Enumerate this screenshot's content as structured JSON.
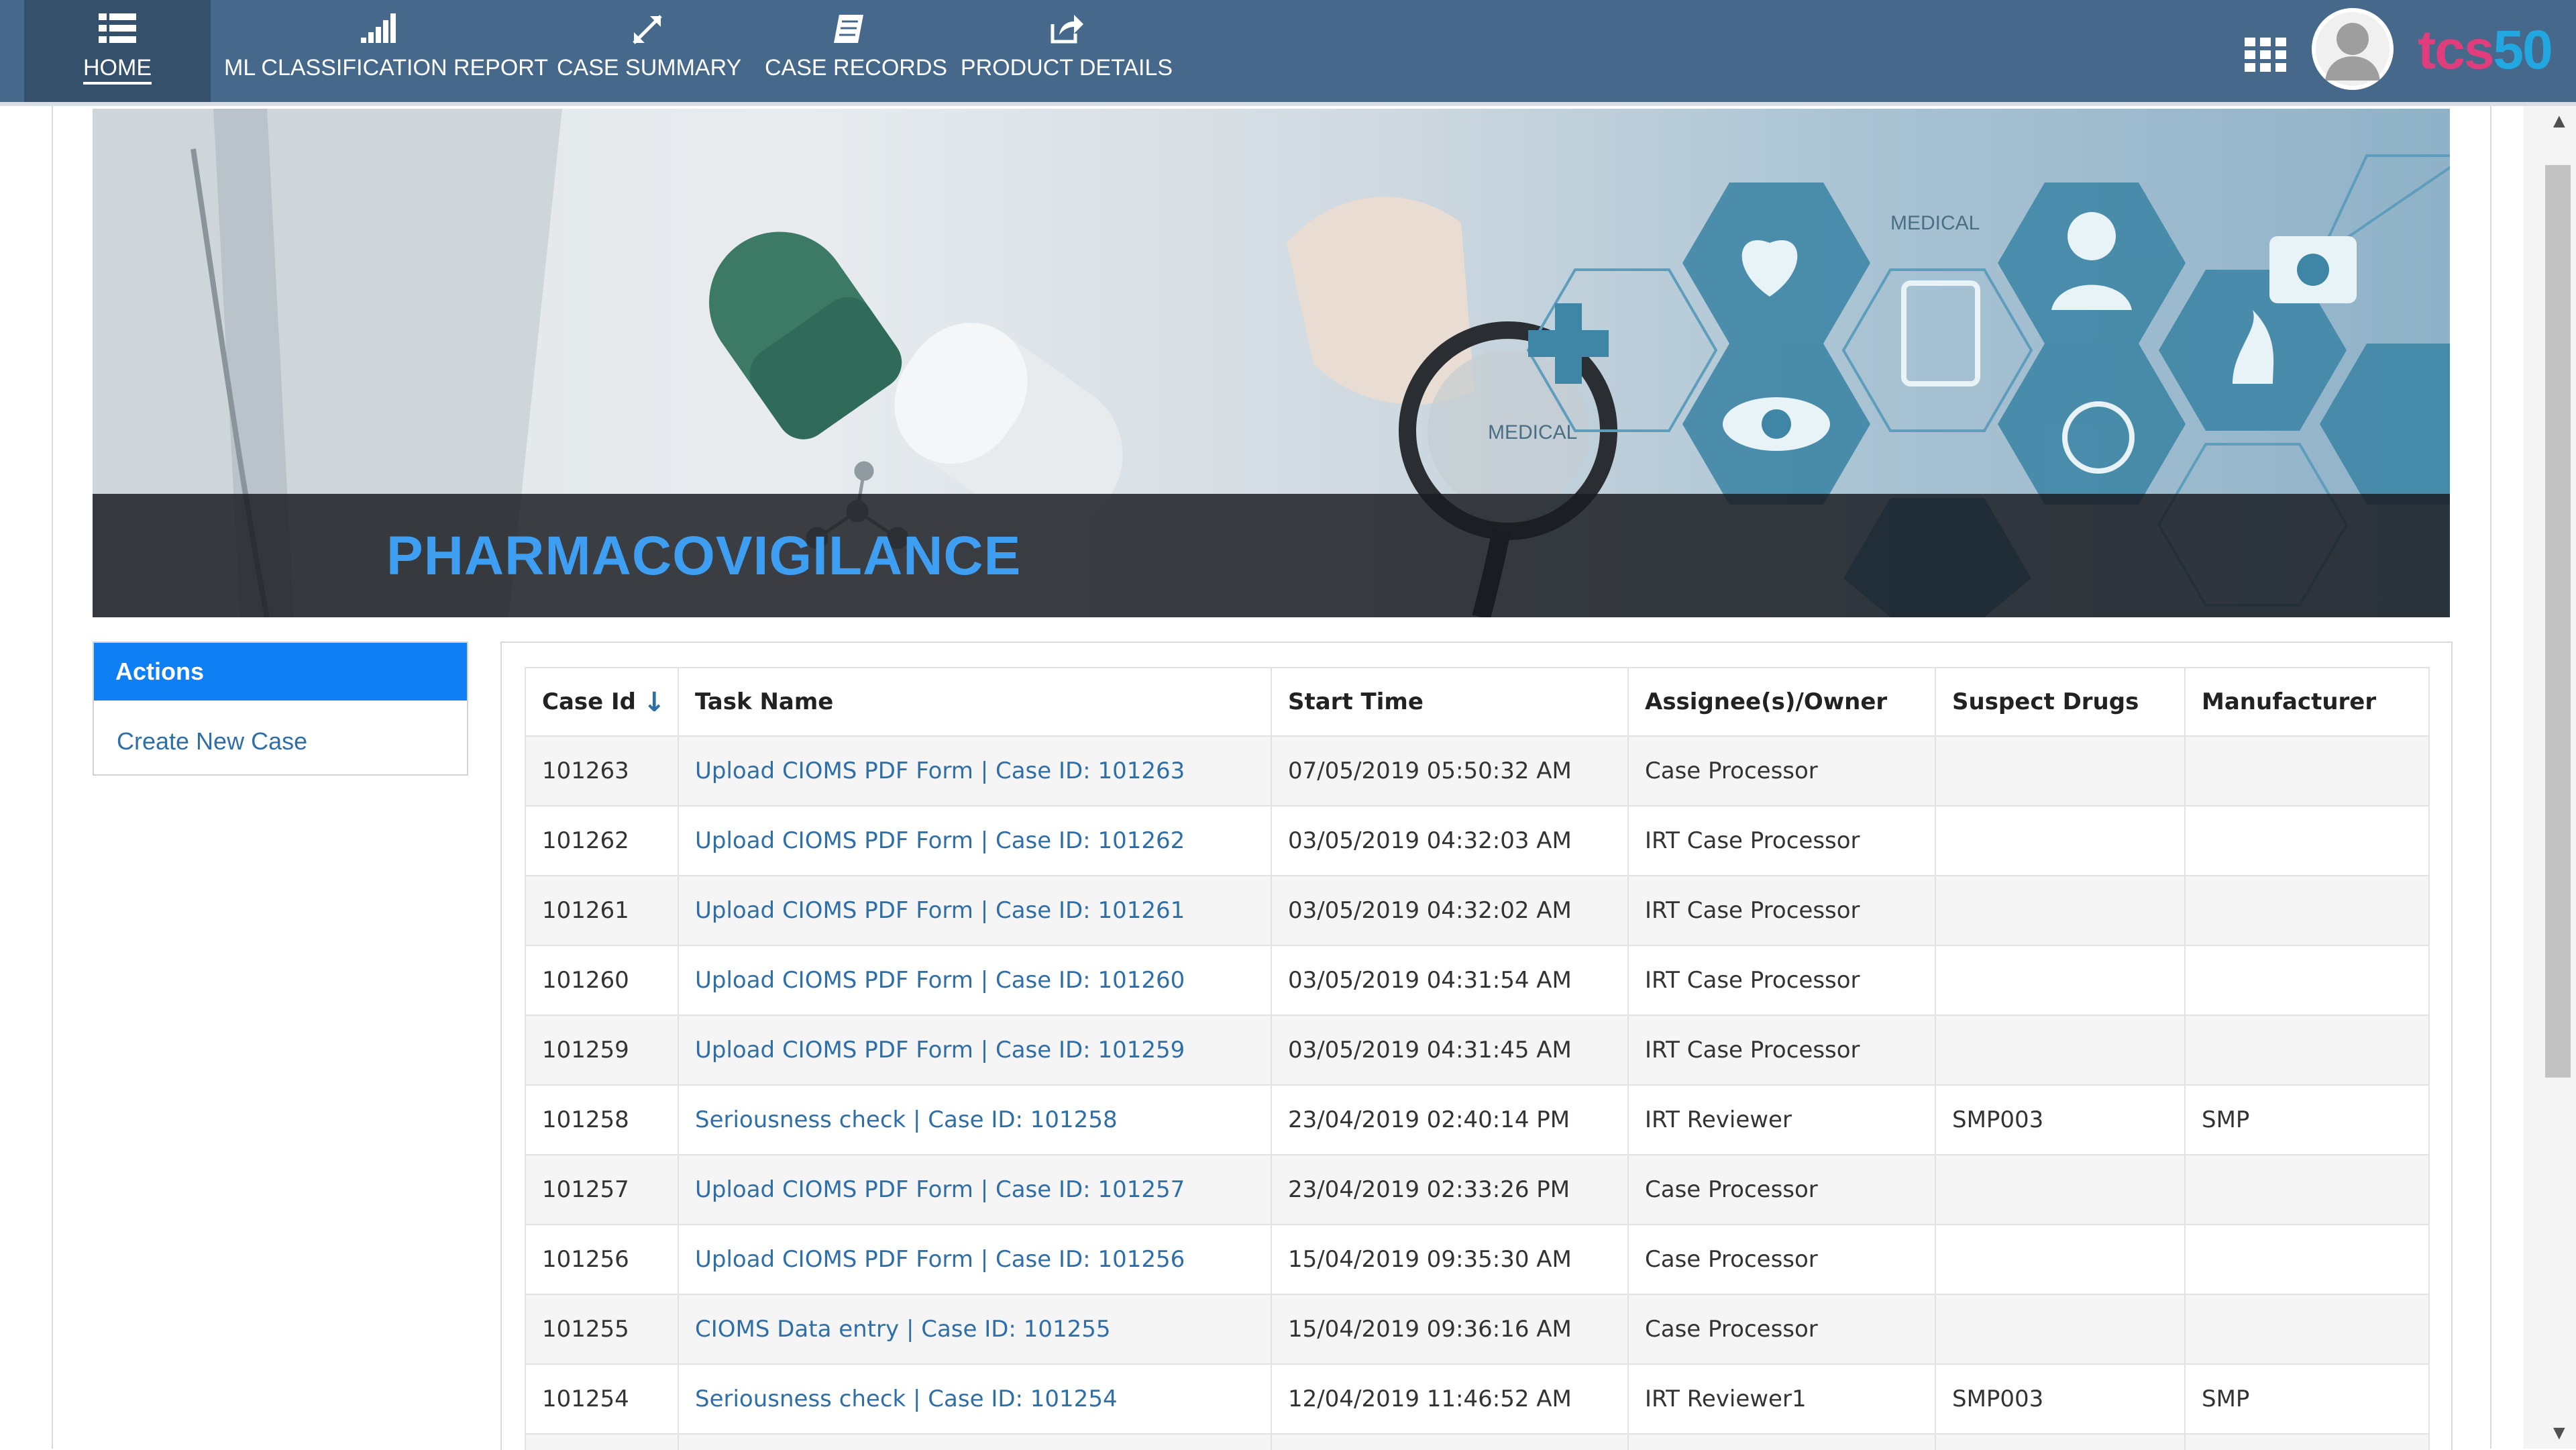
{
  "nav": {
    "items": [
      {
        "label": "HOME",
        "icon": "list-icon"
      },
      {
        "label": "ML CLASSIFICATION REPORT",
        "icon": "signal-bars-icon"
      },
      {
        "label": "CASE SUMMARY",
        "icon": "expand-icon"
      },
      {
        "label": "CASE RECORDS",
        "icon": "document-icon"
      },
      {
        "label": "PRODUCT DETAILS",
        "icon": "share-icon"
      }
    ],
    "brand_part1": "tcs",
    "brand_part2": "50",
    "colors": {
      "bar": "#46688a",
      "active": "#34506b"
    }
  },
  "banner": {
    "title": "PHARMACOVIGILANCE",
    "hex_labels": [
      "MEDICAL",
      "MEDICAL"
    ]
  },
  "actions": {
    "header": "Actions",
    "link": "Create New Case"
  },
  "table": {
    "columns": [
      "Case Id",
      "Task Name",
      "Start Time",
      "Assignee(s)/Owner",
      "Suspect Drugs",
      "Manufacturer"
    ],
    "sort_column": "Case Id",
    "rows": [
      [
        "101263",
        "Upload CIOMS PDF Form | Case ID: 101263",
        "07/05/2019 05:50:32 AM",
        "Case Processor",
        "",
        ""
      ],
      [
        "101262",
        "Upload CIOMS PDF Form | Case ID: 101262",
        "03/05/2019 04:32:03 AM",
        "IRT Case Processor",
        "",
        ""
      ],
      [
        "101261",
        "Upload CIOMS PDF Form | Case ID: 101261",
        "03/05/2019 04:32:02 AM",
        "IRT Case Processor",
        "",
        ""
      ],
      [
        "101260",
        "Upload CIOMS PDF Form | Case ID: 101260",
        "03/05/2019 04:31:54 AM",
        "IRT Case Processor",
        "",
        ""
      ],
      [
        "101259",
        "Upload CIOMS PDF Form | Case ID: 101259",
        "03/05/2019 04:31:45 AM",
        "IRT Case Processor",
        "",
        ""
      ],
      [
        "101258",
        "Seriousness check | Case ID: 101258",
        "23/04/2019 02:40:14 PM",
        "IRT Reviewer",
        "SMP003",
        "SMP"
      ],
      [
        "101257",
        "Upload CIOMS PDF Form | Case ID: 101257",
        "23/04/2019 02:33:26 PM",
        "Case Processor",
        "",
        ""
      ],
      [
        "101256",
        "Upload CIOMS PDF Form | Case ID: 101256",
        "15/04/2019 09:35:30 AM",
        "Case Processor",
        "",
        ""
      ],
      [
        "101255",
        "CIOMS Data entry | Case ID: 101255",
        "15/04/2019 09:36:16 AM",
        "Case Processor",
        "",
        ""
      ],
      [
        "101254",
        "Seriousness check | Case ID: 101254",
        "12/04/2019 11:46:52 AM",
        "IRT Reviewer1",
        "SMP003",
        "SMP"
      ],
      [
        "",
        "",
        "",
        "",
        "",
        ""
      ]
    ]
  }
}
